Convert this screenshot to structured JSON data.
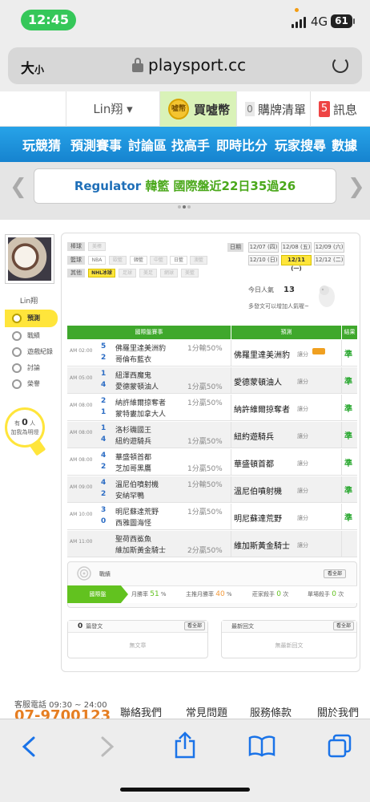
{
  "status": {
    "time": "12:45",
    "network": "4G",
    "battery": "61"
  },
  "browser": {
    "text_size": "大",
    "text_size_small": "小",
    "host": "playsport.cc"
  },
  "topnav": {
    "user": "Lin翔",
    "buy_label": "買噓幣",
    "coin_icon_text": "噓幣",
    "buylist_count": "0",
    "buylist_label": "購牌清單",
    "msg_count": "5",
    "msg_label": "訊息"
  },
  "mainnav": [
    "玩競猜",
    "預測賽事",
    "討論區",
    "找高手",
    "即時比分",
    "玩家搜尋",
    "數據"
  ],
  "banner": {
    "team": "Regulator",
    "text": "韓籃 國際盤近22日35過26"
  },
  "sidebar": {
    "username": "Lin翔",
    "menu": [
      {
        "label": "預測",
        "active": true
      },
      {
        "label": "戰績",
        "active": false
      },
      {
        "label": "遊戲紀錄",
        "active": false
      },
      {
        "label": "討論",
        "active": false
      },
      {
        "label": "榮譽",
        "active": false
      }
    ],
    "fans_pre": "有",
    "fans_count": "0",
    "fans_unit": "人",
    "fans_text": "加我為明燈"
  },
  "filters": {
    "rows": [
      {
        "label": "棒球",
        "items": [
          {
            "text": "美棒",
            "state": "off"
          }
        ]
      },
      {
        "label": "籃球",
        "items": [
          {
            "text": "NBA",
            "state": "on"
          },
          {
            "text": "歐籃",
            "state": "off"
          },
          {
            "text": "韓籃",
            "state": "on"
          },
          {
            "text": "中籃",
            "state": "off"
          },
          {
            "text": "日籃",
            "state": "on"
          },
          {
            "text": "澳籃",
            "state": "off"
          }
        ]
      },
      {
        "label": "其他",
        "items": [
          {
            "text": "NHL冰球",
            "state": "sel"
          },
          {
            "text": "足球",
            "state": "off"
          },
          {
            "text": "美足",
            "state": "off"
          },
          {
            "text": "網球",
            "state": "off"
          },
          {
            "text": "美籃",
            "state": "off"
          }
        ]
      }
    ],
    "date_label": "日期",
    "dates": [
      {
        "text": "12/07 (四)",
        "sel": false
      },
      {
        "text": "12/08 (五)",
        "sel": false
      },
      {
        "text": "12/09 (六)",
        "sel": false
      },
      {
        "text": "12/10 (日)",
        "sel": false
      },
      {
        "text": "12/11 (一)",
        "sel": true
      },
      {
        "text": "12/12 (二)",
        "sel": false
      }
    ]
  },
  "views": {
    "label": "今日人氣",
    "count": "13",
    "sub": "多發文可以增加人氣喔~"
  },
  "table": {
    "headers": [
      "國際盤賽事",
      "預測",
      "結果"
    ],
    "rows": [
      {
        "time": "AM 02:00",
        "s1": "5",
        "s2": "2",
        "t1": "佛羅里達美洲豹",
        "t2": "哥倫布藍衣",
        "line": "1分輸50%",
        "line_row": 1,
        "pick": "佛羅里達美洲豹",
        "pk": "讓分",
        "hot": true,
        "result": "準"
      },
      {
        "time": "AM 05:00",
        "s1": "1",
        "s2": "4",
        "t1": "紐澤西魔鬼",
        "t2": "愛德蒙頓油人",
        "line": "1分贏50%",
        "line_row": 2,
        "pick": "愛德蒙頓油人",
        "pk": "讓分",
        "hot": false,
        "result": "準"
      },
      {
        "time": "AM 08:00",
        "s1": "2",
        "s2": "1",
        "t1": "納許維爾掠奪者",
        "t2": "蒙特婁加拿大人",
        "line": "1分贏50%",
        "line_row": 1,
        "pick": "納許維爾掠奪者",
        "pk": "讓分",
        "hot": false,
        "result": "準"
      },
      {
        "time": "AM 08:00",
        "s1": "1",
        "s2": "4",
        "t1": "洛杉磯國王",
        "t2": "紐約遊騎兵",
        "line": "1分贏50%",
        "line_row": 2,
        "pick": "紐約遊騎兵",
        "pk": "讓分",
        "hot": false,
        "result": "準"
      },
      {
        "time": "AM 08:00",
        "s1": "4",
        "s2": "2",
        "t1": "華盛頓首都",
        "t2": "芝加哥黑鷹",
        "line": "1分贏50%",
        "line_row": 2,
        "pick": "華盛頓首都",
        "pk": "讓分",
        "hot": false,
        "result": "準"
      },
      {
        "time": "AM 09:00",
        "s1": "4",
        "s2": "2",
        "t1": "溫尼伯噴射機",
        "t2": "安納罕鴨",
        "line": "1分輸50%",
        "line_row": 1,
        "pick": "溫尼伯噴射機",
        "pk": "讓分",
        "hot": false,
        "result": "準"
      },
      {
        "time": "AM 10:00",
        "s1": "3",
        "s2": "0",
        "t1": "明尼蘇達荒野",
        "t2": "西雅圖海怪",
        "line": "1分贏50%",
        "line_row": 1,
        "pick": "明尼蘇達荒野",
        "pk": "讓分",
        "hot": false,
        "result": "準"
      },
      {
        "time": "AM 11:00",
        "s1": "",
        "s2": "",
        "t1": "聖荷西鯊魚",
        "t2": "維加斯黃金騎士",
        "line": "2分贏50%",
        "line_row": 2,
        "pick": "維加斯黃金騎士",
        "pk": "讓分",
        "hot": false,
        "result": ""
      }
    ]
  },
  "record": {
    "title": "戰績",
    "more": "看全部",
    "tag": "國際盤",
    "month_win_label": "月勝率",
    "month_win": "51",
    "pct": "%",
    "main_win_label": "主推月勝率",
    "main_win": "40",
    "banker_label": "莊家殺手",
    "banker": "0",
    "times": "次",
    "bankrupt_label": "單場殺手",
    "bankrupt": "0"
  },
  "posts": {
    "count": "0",
    "label": "篇發文",
    "more": "看全部",
    "empty": "無文章",
    "reply_label": "最新回文",
    "reply_empty": "無最新回文"
  },
  "footer": {
    "phone_label": "客服電話 09:30 ~ 24:00",
    "phone": "07-9700123",
    "links": [
      "聯絡我們",
      "常見問題",
      "服務條款",
      "關於我們"
    ]
  }
}
